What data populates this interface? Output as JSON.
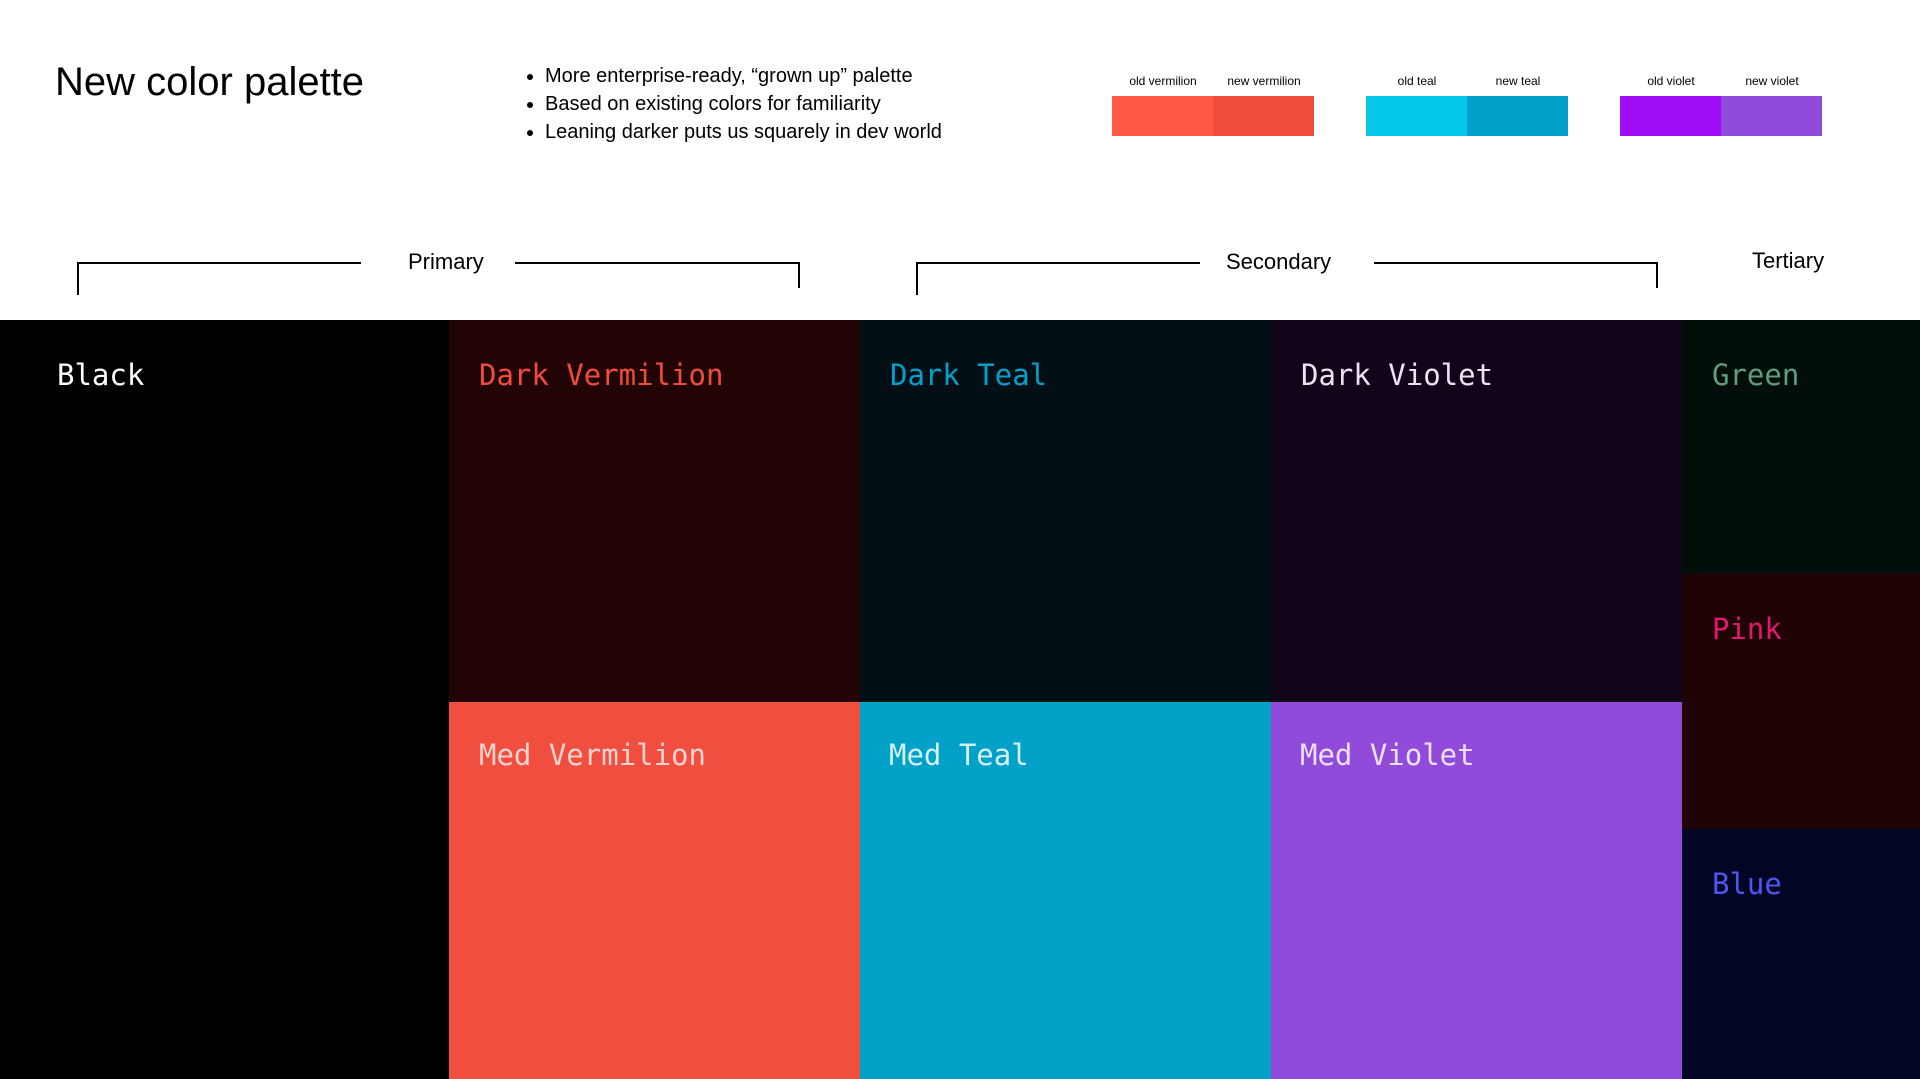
{
  "title": "New color palette",
  "bullets": [
    "More enterprise-ready, “grown up” palette",
    "Based on existing colors for familiarity",
    "Leaning darker puts us squarely in dev world"
  ],
  "comparisons": [
    {
      "old_label": "old vermilion",
      "new_label": "new vermilion",
      "old_color": "#ff5945",
      "new_color": "#f04c3e"
    },
    {
      "old_label": "old teal",
      "new_label": "new teal",
      "old_color": "#05c8e8",
      "new_color": "#04a0cc"
    },
    {
      "old_label": "old violet",
      "new_label": "new violet",
      "old_color": "#a10cf7",
      "new_color": "#914bdb"
    }
  ],
  "groups": {
    "primary": "Primary",
    "secondary": "Secondary",
    "tertiary": "Tertiary"
  },
  "tiles": {
    "black": {
      "name": "Black",
      "bg": "#000000",
      "fg": "#ffffff"
    },
    "dark_vermilion": {
      "name": "Dark Vermilion",
      "bg": "#220404",
      "fg": "#f04c3e"
    },
    "med_vermilion": {
      "name": "Med Vermilion",
      "bg": "#f04f3f",
      "fg": "#fbd2cd"
    },
    "dark_teal": {
      "name": "Dark Teal",
      "bg": "#020f15",
      "fg": "#04a0cc"
    },
    "med_teal": {
      "name": "Med Teal",
      "bg": "#01a1c8",
      "fg": "#d4f1f7"
    },
    "dark_violet": {
      "name": "Dark Violet",
      "bg": "#11051a",
      "fg": "#e9e3f2"
    },
    "med_violet": {
      "name": "Med Violet",
      "bg": "#914bdb",
      "fg": "#ece0f8"
    },
    "green": {
      "name": "Green",
      "bg": "#010e09",
      "fg": "#5e9e7c"
    },
    "pink": {
      "name": "Pink",
      "bg": "#200405",
      "fg": "#e0186e"
    },
    "blue": {
      "name": "Blue",
      "bg": "#030525",
      "fg": "#4b57f1"
    }
  }
}
